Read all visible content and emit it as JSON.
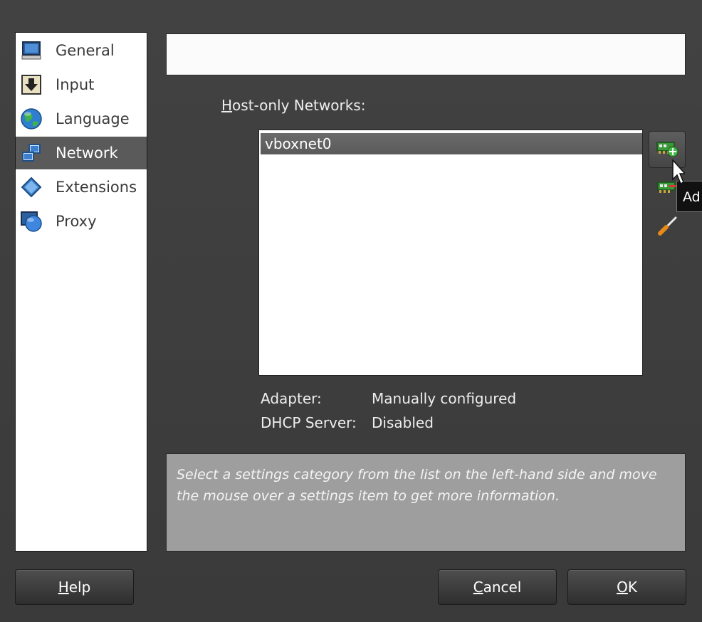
{
  "sidebar": {
    "items": [
      {
        "label": "General",
        "icon": "monitor-icon"
      },
      {
        "label": "Input",
        "icon": "input-icon"
      },
      {
        "label": "Language",
        "icon": "globe-icon"
      },
      {
        "label": "Network",
        "icon": "network-icon",
        "selected": true
      },
      {
        "label": "Extensions",
        "icon": "diamond-icon"
      },
      {
        "label": "Proxy",
        "icon": "proxy-globe-icon"
      }
    ]
  },
  "network": {
    "section_label_first": "H",
    "section_label_rest": "ost-only Networks:",
    "list": [
      "vboxnet0"
    ],
    "tooltip": "Ad",
    "adapter_label": "Adapter:",
    "adapter_value": "Manually configured",
    "dhcp_label": "DHCP Server:",
    "dhcp_value": "Disabled"
  },
  "description": "Select a settings category from the list on the left-hand side and move the mouse over a settings item to get more information.",
  "buttons": {
    "help_first": "H",
    "help_rest": "elp",
    "cancel_first": "C",
    "cancel_rest": "ancel",
    "ok_first": "O",
    "ok_rest": "K"
  },
  "colors": {
    "background": "#3c3c3c",
    "selection": "#5a5a5a",
    "description_bg": "#9e9e9e"
  }
}
